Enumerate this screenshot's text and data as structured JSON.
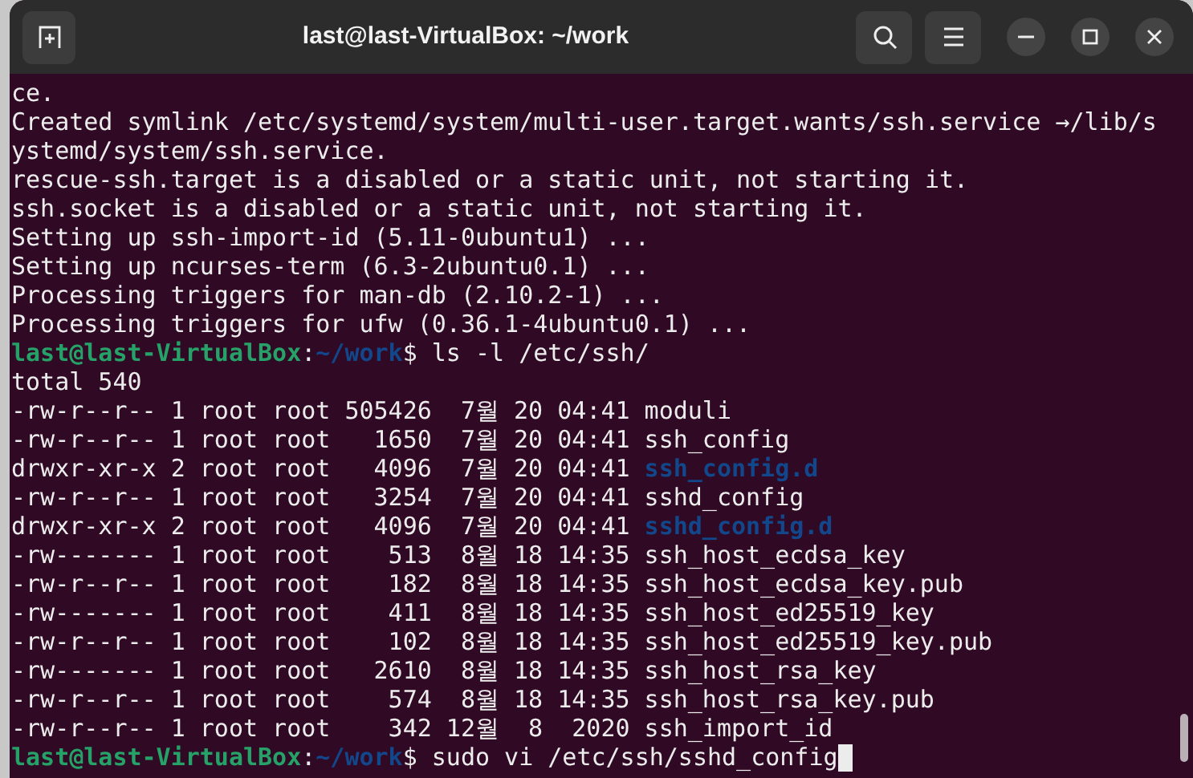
{
  "window": {
    "title": "last@last-VirtualBox: ~/work"
  },
  "lines": [
    {
      "segments": [
        {
          "text": "ce.",
          "kind": "plain"
        }
      ]
    },
    {
      "segments": [
        {
          "text": "Created symlink /etc/systemd/system/multi-user.target.wants/ssh.service →/lib/s",
          "kind": "plain"
        }
      ]
    },
    {
      "segments": [
        {
          "text": "ystemd/system/ssh.service.",
          "kind": "plain"
        }
      ]
    },
    {
      "segments": [
        {
          "text": "rescue-ssh.target is a disabled or a static unit, not starting it.",
          "kind": "plain"
        }
      ]
    },
    {
      "segments": [
        {
          "text": "ssh.socket is a disabled or a static unit, not starting it.",
          "kind": "plain"
        }
      ]
    },
    {
      "segments": [
        {
          "text": "Setting up ssh-import-id (5.11-0ubuntu1) ...",
          "kind": "plain"
        }
      ]
    },
    {
      "segments": [
        {
          "text": "Setting up ncurses-term (6.3-2ubuntu0.1) ...",
          "kind": "plain"
        }
      ]
    },
    {
      "segments": [
        {
          "text": "Processing triggers for man-db (2.10.2-1) ...",
          "kind": "plain"
        }
      ]
    },
    {
      "segments": [
        {
          "text": "Processing triggers for ufw (0.36.1-4ubuntu0.1) ...",
          "kind": "plain"
        }
      ]
    },
    {
      "segments": [
        {
          "text": "last@last-VirtualBox",
          "kind": "user"
        },
        {
          "text": ":",
          "kind": "plain"
        },
        {
          "text": "~/work",
          "kind": "path"
        },
        {
          "text": "$ ls -l /etc/ssh/",
          "kind": "plain"
        }
      ]
    },
    {
      "segments": [
        {
          "text": "total 540",
          "kind": "plain"
        }
      ]
    },
    {
      "segments": [
        {
          "text": "-rw-r--r-- 1 root root 505426  7월 20 04:41 moduli",
          "kind": "plain"
        }
      ]
    },
    {
      "segments": [
        {
          "text": "-rw-r--r-- 1 root root   1650  7월 20 04:41 ssh_config",
          "kind": "plain"
        }
      ]
    },
    {
      "segments": [
        {
          "text": "drwxr-xr-x 2 root root   4096  7월 20 04:41 ",
          "kind": "plain"
        },
        {
          "text": "ssh_config.d",
          "kind": "dir"
        }
      ]
    },
    {
      "segments": [
        {
          "text": "-rw-r--r-- 1 root root   3254  7월 20 04:41 sshd_config",
          "kind": "plain"
        }
      ]
    },
    {
      "segments": [
        {
          "text": "drwxr-xr-x 2 root root   4096  7월 20 04:41 ",
          "kind": "plain"
        },
        {
          "text": "sshd_config.d",
          "kind": "dir"
        }
      ]
    },
    {
      "segments": [
        {
          "text": "-rw------- 1 root root    513  8월 18 14:35 ssh_host_ecdsa_key",
          "kind": "plain"
        }
      ]
    },
    {
      "segments": [
        {
          "text": "-rw-r--r-- 1 root root    182  8월 18 14:35 ssh_host_ecdsa_key.pub",
          "kind": "plain"
        }
      ]
    },
    {
      "segments": [
        {
          "text": "-rw------- 1 root root    411  8월 18 14:35 ssh_host_ed25519_key",
          "kind": "plain"
        }
      ]
    },
    {
      "segments": [
        {
          "text": "-rw-r--r-- 1 root root    102  8월 18 14:35 ssh_host_ed25519_key.pub",
          "kind": "plain"
        }
      ]
    },
    {
      "segments": [
        {
          "text": "-rw------- 1 root root   2610  8월 18 14:35 ssh_host_rsa_key",
          "kind": "plain"
        }
      ]
    },
    {
      "segments": [
        {
          "text": "-rw-r--r-- 1 root root    574  8월 18 14:35 ssh_host_rsa_key.pub",
          "kind": "plain"
        }
      ]
    },
    {
      "segments": [
        {
          "text": "-rw-r--r-- 1 root root    342 12월  8  2020 ssh_import_id",
          "kind": "plain"
        }
      ]
    },
    {
      "segments": [
        {
          "text": "last@last-VirtualBox",
          "kind": "user"
        },
        {
          "text": ":",
          "kind": "plain"
        },
        {
          "text": "~/work",
          "kind": "path"
        },
        {
          "text": "$ sudo vi /etc/ssh/sshd_config",
          "kind": "plain"
        }
      ],
      "cursor": true
    }
  ]
}
